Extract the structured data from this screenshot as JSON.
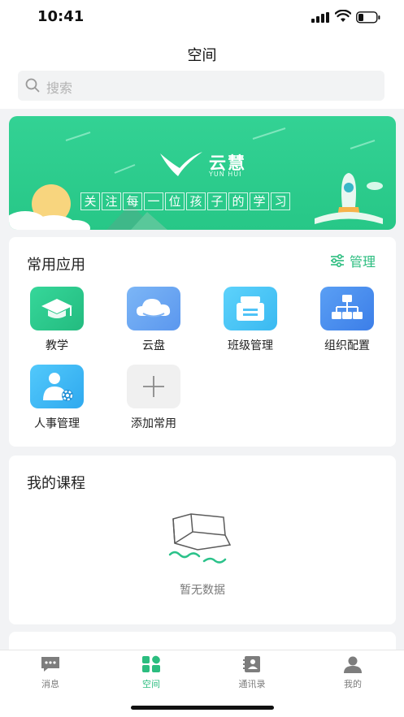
{
  "status_bar": {
    "time": "10:41"
  },
  "header": {
    "title": "空间"
  },
  "search": {
    "placeholder": "搜索"
  },
  "banner": {
    "brand": "云慧",
    "brand_en": "YUN HUI",
    "slogan": [
      "关",
      "注",
      "每",
      "一",
      "位",
      "孩",
      "子",
      "的",
      "学",
      "习"
    ]
  },
  "apps_section": {
    "title": "常用应用",
    "manage_label": "管理",
    "items": [
      {
        "label": "教学",
        "icon": "graduation-cap-icon",
        "color": "#2ecc8e"
      },
      {
        "label": "云盘",
        "icon": "cloud-icon",
        "color": "#6aa7f3"
      },
      {
        "label": "班级管理",
        "icon": "class-badge-icon",
        "color": "#4fc3f7"
      },
      {
        "label": "组织配置",
        "icon": "org-chart-icon",
        "color": "#4a8df0"
      },
      {
        "label": "人事管理",
        "icon": "user-gear-icon",
        "color": "#37b7f5"
      },
      {
        "label": "添加常用",
        "icon": "plus-icon",
        "color": "#f0f0f0"
      }
    ]
  },
  "course_section": {
    "title": "我的课程",
    "empty_text": "暂无数据"
  },
  "tabbar": {
    "items": [
      {
        "label": "消息",
        "icon": "message-icon"
      },
      {
        "label": "空间",
        "icon": "grid-icon",
        "active": true
      },
      {
        "label": "通讯录",
        "icon": "contacts-icon"
      },
      {
        "label": "我的",
        "icon": "profile-icon"
      }
    ]
  },
  "colors": {
    "accent": "#2bbd7f",
    "banner": "#2dcd8f"
  }
}
